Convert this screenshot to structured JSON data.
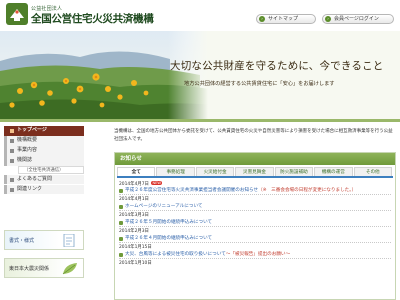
{
  "header": {
    "org_subtitle": "公益社団法人",
    "org_name": "全国公営住宅火災共済機構",
    "sitemap_label": "サイトマップ",
    "member_label": "会員ページログイン"
  },
  "hero": {
    "headline": "大切な公共財産を守るために、今できること",
    "subline": "地方公共団体の経営する公共賃貸住宅に「安心」をお届けします"
  },
  "nav": {
    "items": [
      {
        "label": "トップページ",
        "active": true
      },
      {
        "label": "機構概要"
      },
      {
        "label": "事業内容"
      },
      {
        "label": "機関誌",
        "sub": "（全住宅共済通信）"
      },
      {
        "label": "よくあるご質問"
      },
      {
        "label": "関連リンク"
      }
    ]
  },
  "banners": {
    "forms_label": "書式・様式",
    "earthquake_label": "東日本大震災関係"
  },
  "intro": {
    "text": "当機構は、全国の地方公共団体から委託を受けて、公共賃貸住宅の火災や自然災害等により損害を受けた場合に相互救済事業等を行う公益社団法人です。"
  },
  "news": {
    "heading": "お知らせ",
    "tabs": [
      "全て",
      "事務処理",
      "火災給付金",
      "災害見舞金",
      "防火施設補助",
      "機構の運営",
      "その他"
    ],
    "items": [
      {
        "date": "2014年4月7日",
        "new": true,
        "title": "平成２６年度公営住宅等火災共済事業担当者会議開催のお知らせ",
        "note": "（※　三番会会場の日程が変更になりました。）"
      },
      {
        "date": "2014年4月1日",
        "new": false,
        "title": "ホームページのリニューアルについて",
        "note": ""
      },
      {
        "date": "2014年3月3日",
        "new": false,
        "title": "平成２６年５月開始の継続申込みについて",
        "note": ""
      },
      {
        "date": "2014年2月3日",
        "new": false,
        "title": "平成２６年４月開始の継続申込みについて",
        "note": ""
      },
      {
        "date": "2014年1月15日",
        "new": false,
        "title": "大災、台風等による被災住宅の取り扱いについて",
        "note": "〜「被災報告」提出のお願い〜"
      },
      {
        "date": "2014年1月10日",
        "new": false,
        "title": "",
        "note": ""
      }
    ]
  },
  "colors": {
    "brand_green": "#6f9a3a",
    "nav_active": "#7b2e1e",
    "link_blue": "#2a5fa8",
    "tab_underline": "#3c7fbf"
  },
  "icons": {
    "logo": "emblem-icon",
    "header_button": "arrow-circle-icon",
    "nav_bullet": "square-bullet-icon",
    "news_bullet": "arrow-square-icon"
  }
}
